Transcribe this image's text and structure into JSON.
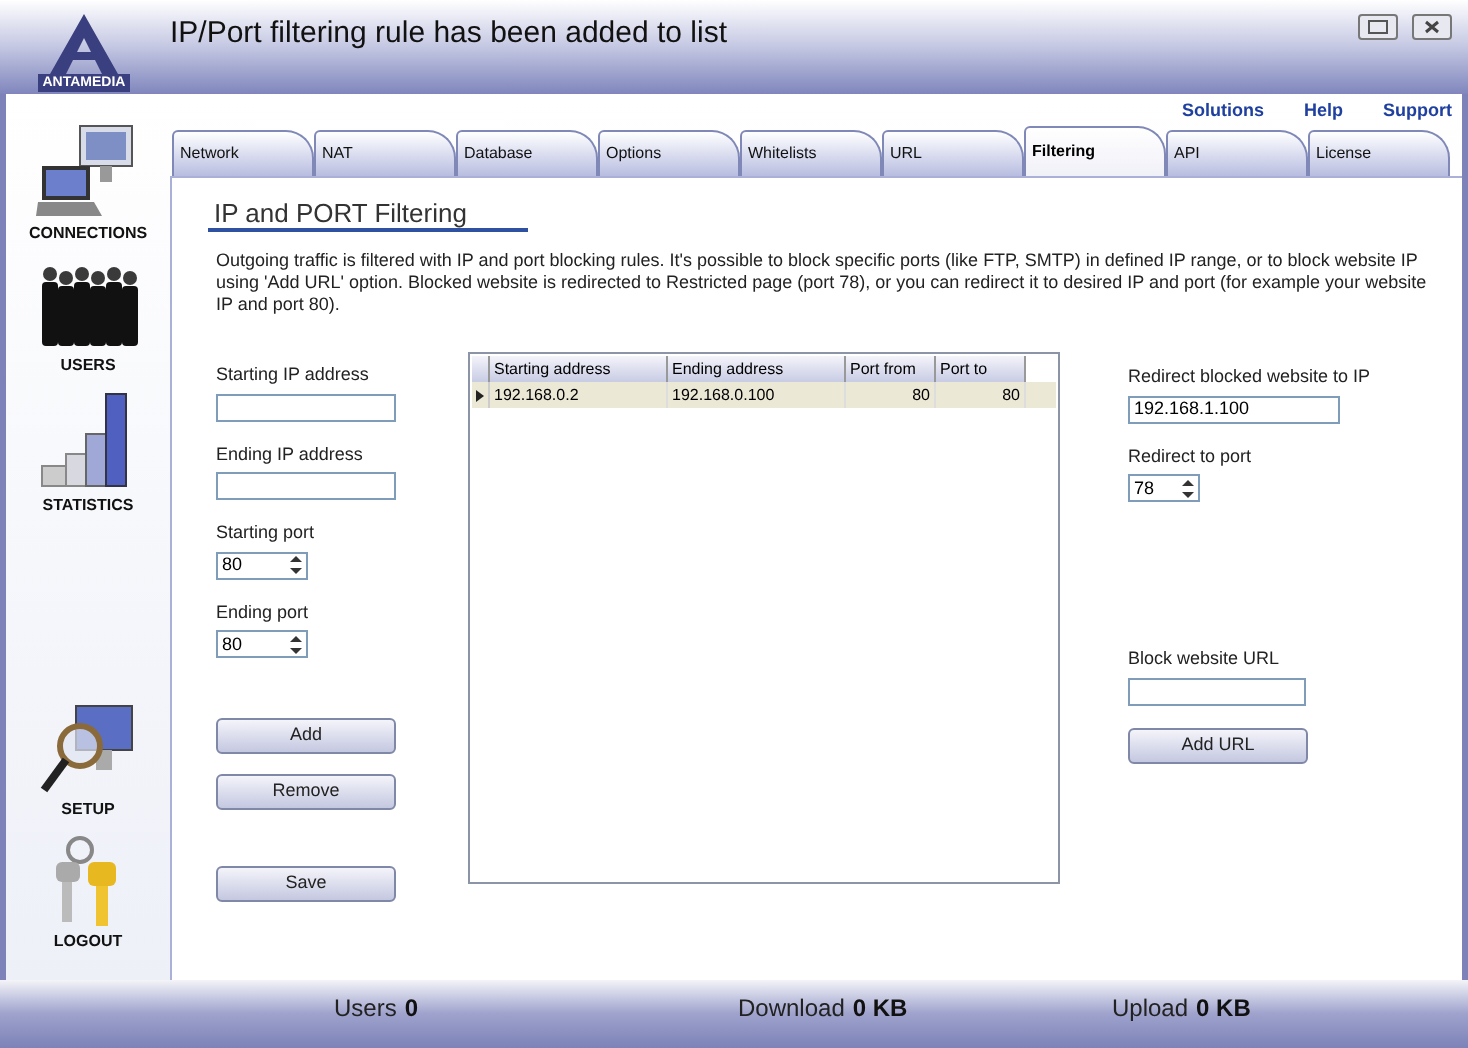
{
  "window": {
    "title": "IP/Port filtering rule has been added to list",
    "logo": "ANTAMEDIA"
  },
  "sidebar": {
    "items": [
      {
        "label": "CONNECTIONS",
        "kind": "connections"
      },
      {
        "label": "USERS",
        "kind": "users"
      },
      {
        "label": "STATISTICS",
        "kind": "statistics"
      },
      {
        "label": "SETUP",
        "kind": "setup"
      },
      {
        "label": "LOGOUT",
        "kind": "logout"
      }
    ]
  },
  "links": [
    "Solutions",
    "Help",
    "Support"
  ],
  "tabs": [
    {
      "label": "Network",
      "selected": false
    },
    {
      "label": "NAT",
      "selected": false
    },
    {
      "label": "Database",
      "selected": false
    },
    {
      "label": "Options",
      "selected": false
    },
    {
      "label": "Whitelists",
      "selected": false
    },
    {
      "label": "URL",
      "selected": false
    },
    {
      "label": "Filtering",
      "selected": true
    },
    {
      "label": "API",
      "selected": false
    },
    {
      "label": "License",
      "selected": false
    }
  ],
  "section_title": "IP and PORT Filtering",
  "description": "Outgoing traffic is filtered with IP and port blocking rules. It's possible to block specific ports (like FTP, SMTP) in defined IP range, or to block website IP using 'Add URL' option. Blocked website is redirected to Restricted page (port 78), or you can redirect it to desired IP and port (for example your website IP and port 80).",
  "left_fields": [
    {
      "label": "Starting IP address",
      "kind": "text"
    },
    {
      "label": "Ending IP address",
      "kind": "text"
    },
    {
      "label": "Starting port",
      "kind": "spin",
      "value": "80"
    },
    {
      "label": "Ending port",
      "kind": "spin",
      "value": "80"
    }
  ],
  "left_buttons": [
    "Add",
    "Remove",
    "Save"
  ],
  "table": {
    "columns": [
      "Starting address",
      "Ending address",
      "Port from",
      "Port to"
    ],
    "rows": [
      {
        "cells": [
          "192.168.0.2",
          "192.168.0.100",
          "80",
          "80"
        ],
        "selected": true
      }
    ]
  },
  "right_fields": [
    {
      "label": "Redirect blocked website to IP",
      "kind": "text",
      "value": "192.168.1.100"
    },
    {
      "label": "Redirect to port",
      "kind": "spin",
      "value": "78"
    },
    {
      "label": "Block website URL",
      "kind": "text"
    }
  ],
  "right_buttons": [
    "Add URL"
  ],
  "status_bar": [
    {
      "label": "Users",
      "value": "0"
    },
    {
      "label": "Download",
      "value": "0 KB"
    },
    {
      "label": "Upload",
      "value": "0 KB"
    }
  ]
}
